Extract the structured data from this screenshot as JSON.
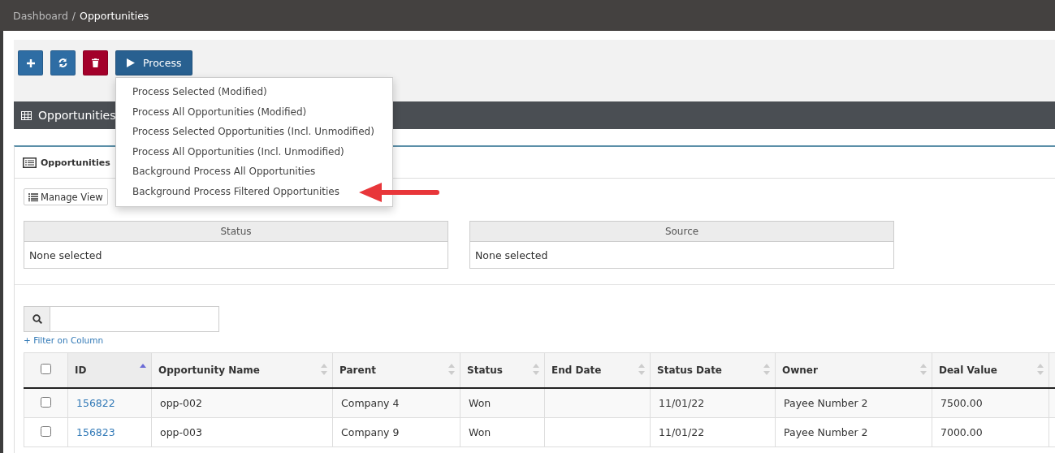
{
  "breadcrumb": [
    {
      "label": "Dashboard",
      "current": false
    },
    {
      "label": "Opportunities",
      "current": true
    }
  ],
  "breadcrumb_separator": "/",
  "toolbar": {
    "process_button": {
      "label": "Process",
      "expanded": true
    }
  },
  "process_menu": [
    "Process Selected (Modified)",
    "Process All Opportunities (Modified)",
    "Process Selected Opportunities (Incl. Unmodified)",
    "Process All Opportunities (Incl. Unmodified)",
    "Background Process All Opportunities",
    "Background Process Filtered Opportunities"
  ],
  "panel": {
    "title": "Opportunities"
  },
  "tab": {
    "label": "Opportunities"
  },
  "manage_view": "Manage View",
  "filters": [
    {
      "label": "Status",
      "value": "None selected"
    },
    {
      "label": "Source",
      "value": "None selected"
    }
  ],
  "filter_link": "+ Filter on Column",
  "table": {
    "select_all": {
      "checked": false
    },
    "columns": [
      {
        "label": "ID",
        "sorted": true
      },
      {
        "label": "Opportunity Name",
        "sorted": false
      },
      {
        "label": "Parent",
        "sorted": false
      },
      {
        "label": "Status",
        "sorted": false
      },
      {
        "label": "End Date",
        "sorted": false
      },
      {
        "label": "Status Date",
        "sorted": false
      },
      {
        "label": "Owner",
        "sorted": false
      },
      {
        "label": "Deal Value",
        "sorted": false
      }
    ],
    "rows": [
      {
        "checked": false,
        "cells": [
          "156822",
          "opp-002",
          "Company 4",
          "Won",
          "",
          "11/01/22",
          "Payee Number 2",
          "7500.00"
        ]
      },
      {
        "checked": false,
        "cells": [
          "156823",
          "opp-003",
          "Company 9",
          "Won",
          "",
          "11/01/22",
          "Payee Number 2",
          "7000.00"
        ]
      }
    ]
  }
}
